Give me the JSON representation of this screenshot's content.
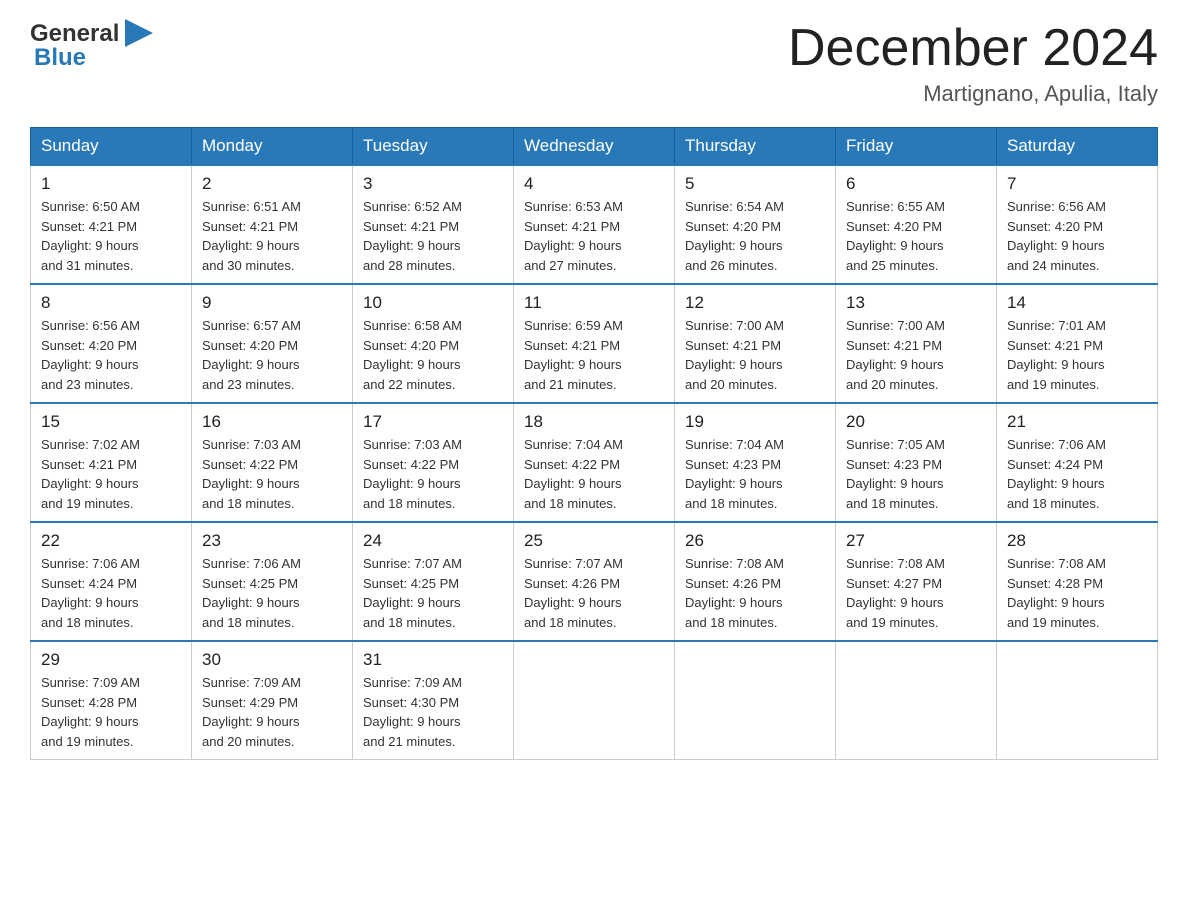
{
  "logo": {
    "text_black": "General",
    "text_blue": "Blue",
    "arrow": true
  },
  "title": {
    "month_year": "December 2024",
    "location": "Martignano, Apulia, Italy"
  },
  "days_of_week": [
    "Sunday",
    "Monday",
    "Tuesday",
    "Wednesday",
    "Thursday",
    "Friday",
    "Saturday"
  ],
  "weeks": [
    [
      {
        "day": "1",
        "sunrise": "6:50 AM",
        "sunset": "4:21 PM",
        "daylight": "9 hours and 31 minutes."
      },
      {
        "day": "2",
        "sunrise": "6:51 AM",
        "sunset": "4:21 PM",
        "daylight": "9 hours and 30 minutes."
      },
      {
        "day": "3",
        "sunrise": "6:52 AM",
        "sunset": "4:21 PM",
        "daylight": "9 hours and 28 minutes."
      },
      {
        "day": "4",
        "sunrise": "6:53 AM",
        "sunset": "4:21 PM",
        "daylight": "9 hours and 27 minutes."
      },
      {
        "day": "5",
        "sunrise": "6:54 AM",
        "sunset": "4:20 PM",
        "daylight": "9 hours and 26 minutes."
      },
      {
        "day": "6",
        "sunrise": "6:55 AM",
        "sunset": "4:20 PM",
        "daylight": "9 hours and 25 minutes."
      },
      {
        "day": "7",
        "sunrise": "6:56 AM",
        "sunset": "4:20 PM",
        "daylight": "9 hours and 24 minutes."
      }
    ],
    [
      {
        "day": "8",
        "sunrise": "6:56 AM",
        "sunset": "4:20 PM",
        "daylight": "9 hours and 23 minutes."
      },
      {
        "day": "9",
        "sunrise": "6:57 AM",
        "sunset": "4:20 PM",
        "daylight": "9 hours and 23 minutes."
      },
      {
        "day": "10",
        "sunrise": "6:58 AM",
        "sunset": "4:20 PM",
        "daylight": "9 hours and 22 minutes."
      },
      {
        "day": "11",
        "sunrise": "6:59 AM",
        "sunset": "4:21 PM",
        "daylight": "9 hours and 21 minutes."
      },
      {
        "day": "12",
        "sunrise": "7:00 AM",
        "sunset": "4:21 PM",
        "daylight": "9 hours and 20 minutes."
      },
      {
        "day": "13",
        "sunrise": "7:00 AM",
        "sunset": "4:21 PM",
        "daylight": "9 hours and 20 minutes."
      },
      {
        "day": "14",
        "sunrise": "7:01 AM",
        "sunset": "4:21 PM",
        "daylight": "9 hours and 19 minutes."
      }
    ],
    [
      {
        "day": "15",
        "sunrise": "7:02 AM",
        "sunset": "4:21 PM",
        "daylight": "9 hours and 19 minutes."
      },
      {
        "day": "16",
        "sunrise": "7:03 AM",
        "sunset": "4:22 PM",
        "daylight": "9 hours and 18 minutes."
      },
      {
        "day": "17",
        "sunrise": "7:03 AM",
        "sunset": "4:22 PM",
        "daylight": "9 hours and 18 minutes."
      },
      {
        "day": "18",
        "sunrise": "7:04 AM",
        "sunset": "4:22 PM",
        "daylight": "9 hours and 18 minutes."
      },
      {
        "day": "19",
        "sunrise": "7:04 AM",
        "sunset": "4:23 PM",
        "daylight": "9 hours and 18 minutes."
      },
      {
        "day": "20",
        "sunrise": "7:05 AM",
        "sunset": "4:23 PM",
        "daylight": "9 hours and 18 minutes."
      },
      {
        "day": "21",
        "sunrise": "7:06 AM",
        "sunset": "4:24 PM",
        "daylight": "9 hours and 18 minutes."
      }
    ],
    [
      {
        "day": "22",
        "sunrise": "7:06 AM",
        "sunset": "4:24 PM",
        "daylight": "9 hours and 18 minutes."
      },
      {
        "day": "23",
        "sunrise": "7:06 AM",
        "sunset": "4:25 PM",
        "daylight": "9 hours and 18 minutes."
      },
      {
        "day": "24",
        "sunrise": "7:07 AM",
        "sunset": "4:25 PM",
        "daylight": "9 hours and 18 minutes."
      },
      {
        "day": "25",
        "sunrise": "7:07 AM",
        "sunset": "4:26 PM",
        "daylight": "9 hours and 18 minutes."
      },
      {
        "day": "26",
        "sunrise": "7:08 AM",
        "sunset": "4:26 PM",
        "daylight": "9 hours and 18 minutes."
      },
      {
        "day": "27",
        "sunrise": "7:08 AM",
        "sunset": "4:27 PM",
        "daylight": "9 hours and 19 minutes."
      },
      {
        "day": "28",
        "sunrise": "7:08 AM",
        "sunset": "4:28 PM",
        "daylight": "9 hours and 19 minutes."
      }
    ],
    [
      {
        "day": "29",
        "sunrise": "7:09 AM",
        "sunset": "4:28 PM",
        "daylight": "9 hours and 19 minutes."
      },
      {
        "day": "30",
        "sunrise": "7:09 AM",
        "sunset": "4:29 PM",
        "daylight": "9 hours and 20 minutes."
      },
      {
        "day": "31",
        "sunrise": "7:09 AM",
        "sunset": "4:30 PM",
        "daylight": "9 hours and 21 minutes."
      },
      null,
      null,
      null,
      null
    ]
  ],
  "labels": {
    "sunrise": "Sunrise:",
    "sunset": "Sunset:",
    "daylight": "Daylight:"
  }
}
